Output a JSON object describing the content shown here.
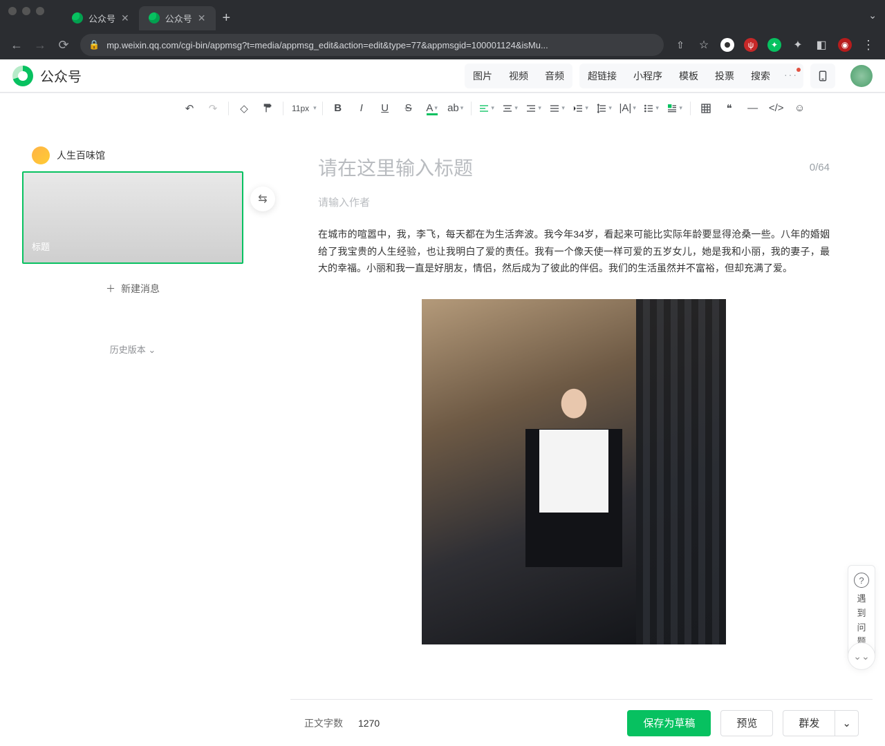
{
  "browser": {
    "tabs": [
      {
        "title": "公众号"
      },
      {
        "title": "公众号"
      }
    ],
    "url": "mp.weixin.qq.com/cgi-bin/appmsg?t=media/appmsg_edit&action=edit&type=77&appmsgid=100001124&isMu..."
  },
  "app": {
    "logo_text": "公众号",
    "header_groups": {
      "media": [
        "图片",
        "视频",
        "音频"
      ],
      "insert": [
        "超链接",
        "小程序",
        "模板",
        "投票",
        "搜索"
      ]
    }
  },
  "toolbar": {
    "font_size": "11px"
  },
  "sidebar": {
    "account_name": "人生百味馆",
    "thumb_label": "标题",
    "new_message": "新建消息",
    "history_label": "历史版本"
  },
  "editor": {
    "title_placeholder": "请在这里输入标题",
    "title_counter": "0/64",
    "author_placeholder": "请输入作者",
    "body": "在城市的喧嚣中，我，李飞，每天都在为生活奔波。我今年34岁，看起来可能比实际年龄要显得沧桑一些。八年的婚姻给了我宝贵的人生经验，也让我明白了爱的责任。我有一个像天使一样可爱的五岁女儿，她是我和小丽，我的妻子，最大的幸福。小丽和我一直是好朋友，情侣，然后成为了彼此的伴侣。我们的生活虽然并不富裕，但却充满了爱。"
  },
  "footer": {
    "count_label": "正文字数",
    "count_value": "1270",
    "save": "保存为草稿",
    "preview": "预览",
    "publish": "群发"
  },
  "help": {
    "c1": "遇",
    "c2": "到",
    "c3": "问",
    "c4": "题"
  }
}
